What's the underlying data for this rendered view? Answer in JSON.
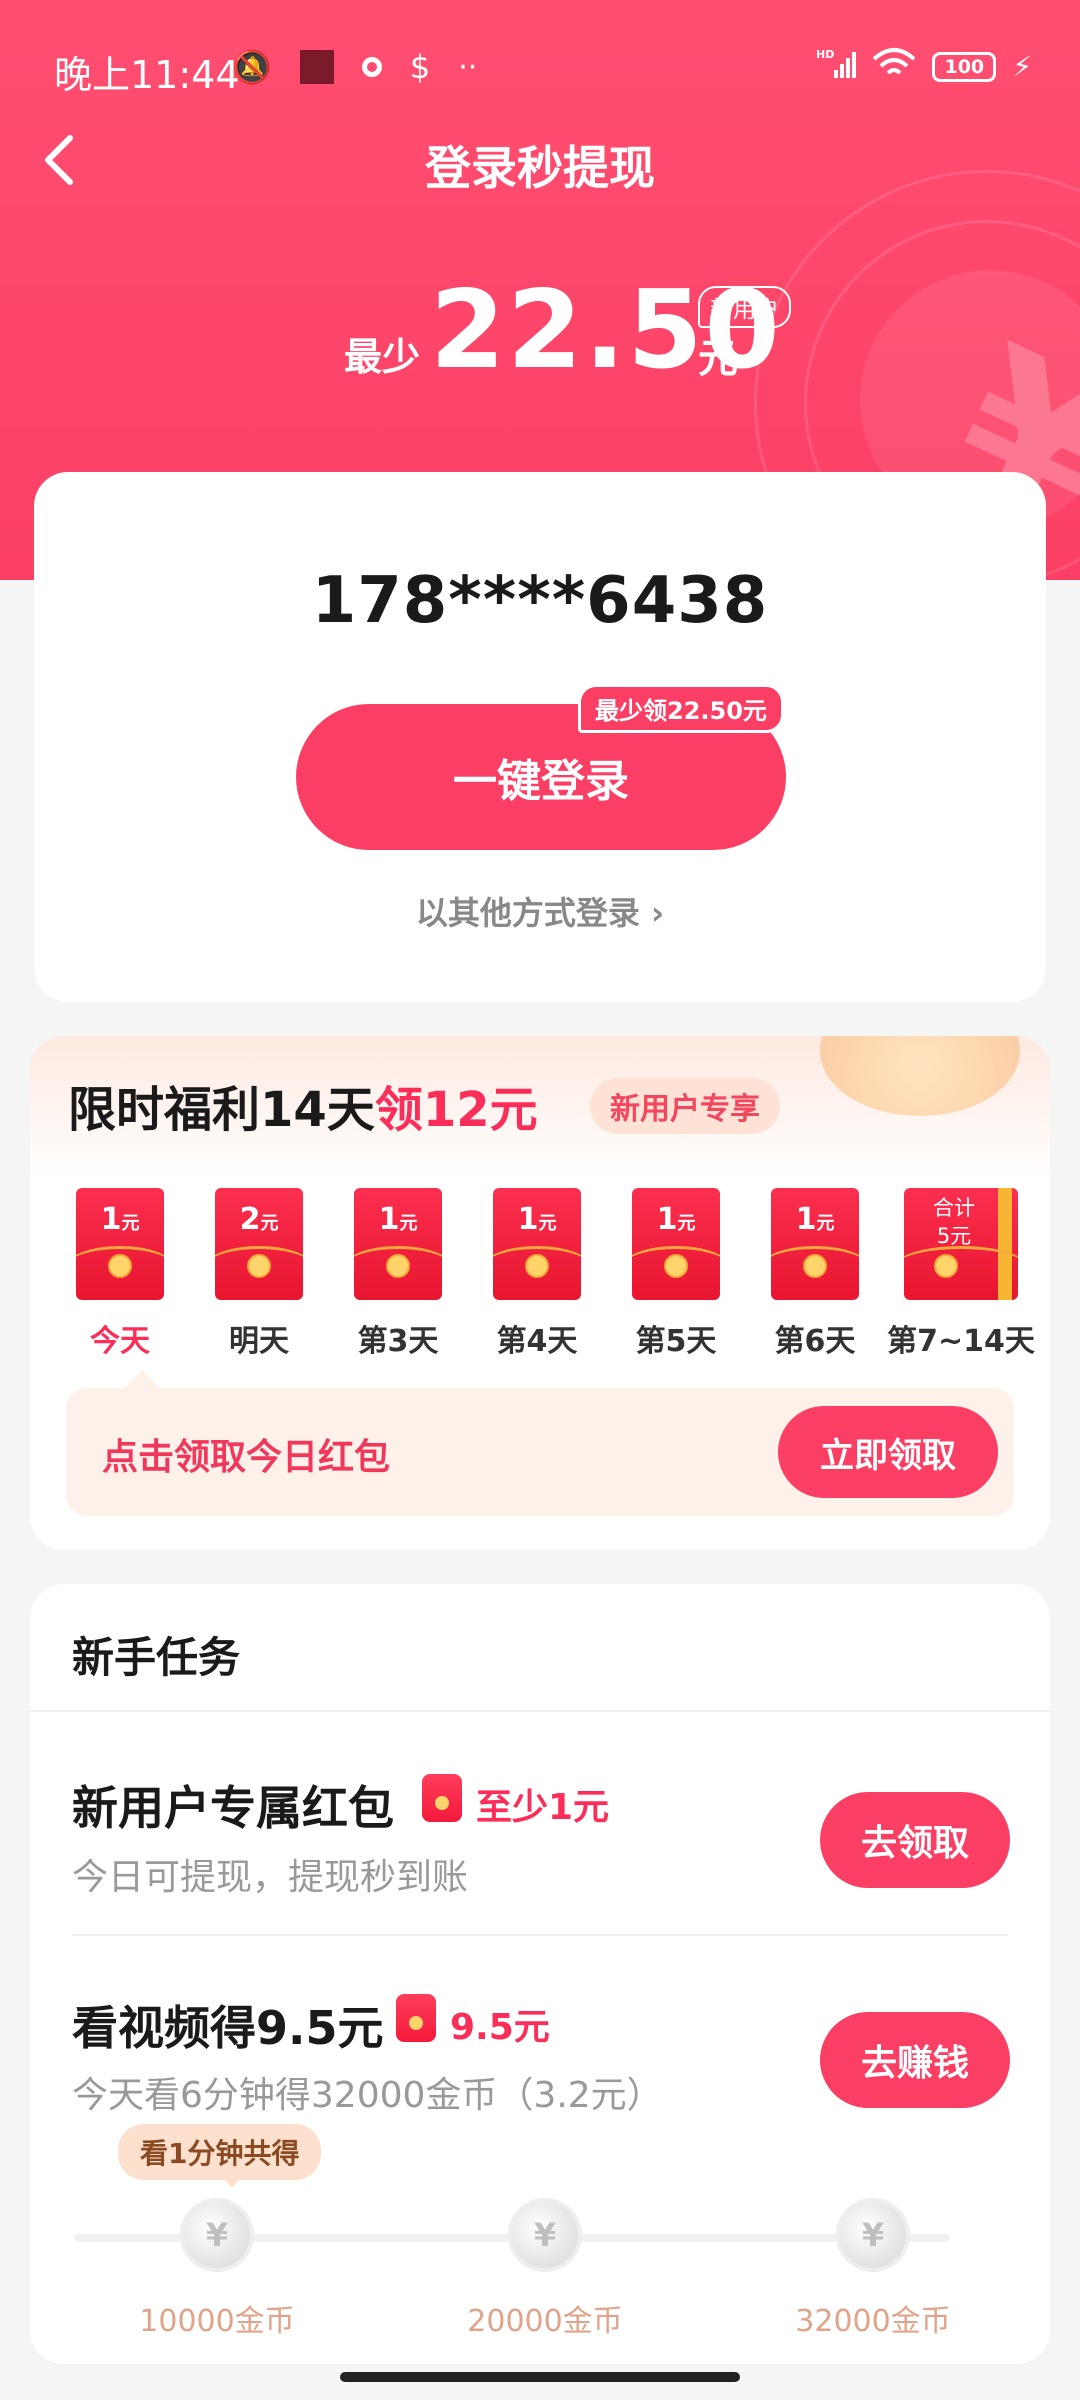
{
  "status_bar": {
    "time": "晚上11:44",
    "battery": "100"
  },
  "header": {
    "title": "登录秒提现",
    "amount_prefix": "最少",
    "amount": "22.50",
    "amount_unit": "元",
    "amount_badge": "新用户"
  },
  "login": {
    "phone": "178****6438",
    "button_label": "一键登录",
    "button_badge": "最少领22.50元",
    "other_login": "以其他方式登录 ›"
  },
  "welfare": {
    "title_prefix": "限时福利14天",
    "title_highlight": "领12元",
    "tag": "新用户专享",
    "days": [
      {
        "amount": "1",
        "unit": "元",
        "label": "今天"
      },
      {
        "amount": "2",
        "unit": "元",
        "label": "明天"
      },
      {
        "amount": "1",
        "unit": "元",
        "label": "第3天"
      },
      {
        "amount": "1",
        "unit": "元",
        "label": "第4天"
      },
      {
        "amount": "1",
        "unit": "元",
        "label": "第5天"
      },
      {
        "amount": "1",
        "unit": "元",
        "label": "第6天"
      },
      {
        "amount_top": "合计",
        "amount_bottom": "5元",
        "label": "第7~14天"
      }
    ],
    "claim_text": "点击领取今日红包",
    "claim_button": "立即领取"
  },
  "tasks": {
    "title": "新手任务",
    "items": [
      {
        "name": "新用户专属红包",
        "reward": "至少1元",
        "desc": "今日可提现，提现秒到账",
        "button": "去领取"
      },
      {
        "name": "看视频得9.5元",
        "reward": "9.5元",
        "desc": "今天看6分钟得32000金币（3.2元）",
        "button": "去赚钱"
      }
    ],
    "tip": "看1分钟共得",
    "milestones": [
      {
        "icon": "¥",
        "label": "10000金币"
      },
      {
        "icon": "¥",
        "label": "20000金币"
      },
      {
        "icon": "¥",
        "label": "32000金币"
      }
    ],
    "progress": 0
  }
}
